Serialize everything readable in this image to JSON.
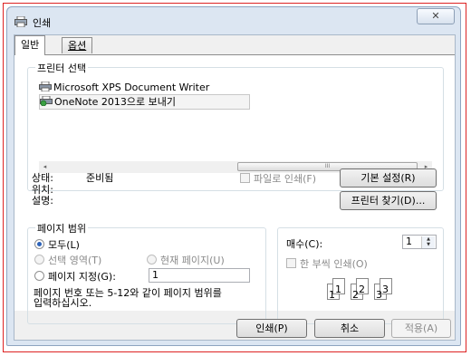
{
  "window": {
    "title": "인쇄",
    "close_glyph": "✕"
  },
  "tabs": [
    {
      "label": "일반"
    },
    {
      "label": "옵션"
    }
  ],
  "printer_select": {
    "legend": "프린터 선택",
    "items": [
      {
        "label": "Microsoft XPS Document Writer"
      },
      {
        "label": "OneNote 2013으로 보내기"
      }
    ],
    "scroll_left": "◂",
    "scroll_right": "▸",
    "scroll_grip": "III"
  },
  "status": {
    "status_label": "상태:",
    "status_value": "준비됨",
    "location_label": "위치:",
    "comment_label": "설명:",
    "print_to_file": "파일로 인쇄(F)",
    "preferences_button": "기본 설정(R)",
    "find_printer_button": "프린터 찾기(D)..."
  },
  "page_range": {
    "legend": "페이지 범위",
    "all": "모두(L)",
    "selection": "선택 영역(T)",
    "current_page": "현재 페이지(U)",
    "pages": "페이지 지정(G):",
    "pages_value": "1",
    "hint_line1": "페이지 번호 또는 5-12와 같이 페이지 범위를",
    "hint_line2": "입력하십시오."
  },
  "copies": {
    "label": "매수(C):",
    "value": "1",
    "spin_up": "▲",
    "spin_down": "▼",
    "collate": "한 부씩 인쇄(O)",
    "collate_nums": [
      "1",
      "1",
      "2",
      "2",
      "3",
      "3"
    ]
  },
  "footer": {
    "print_button": "인쇄(P)",
    "cancel_button": "취소",
    "apply_button": "적용(A)"
  }
}
